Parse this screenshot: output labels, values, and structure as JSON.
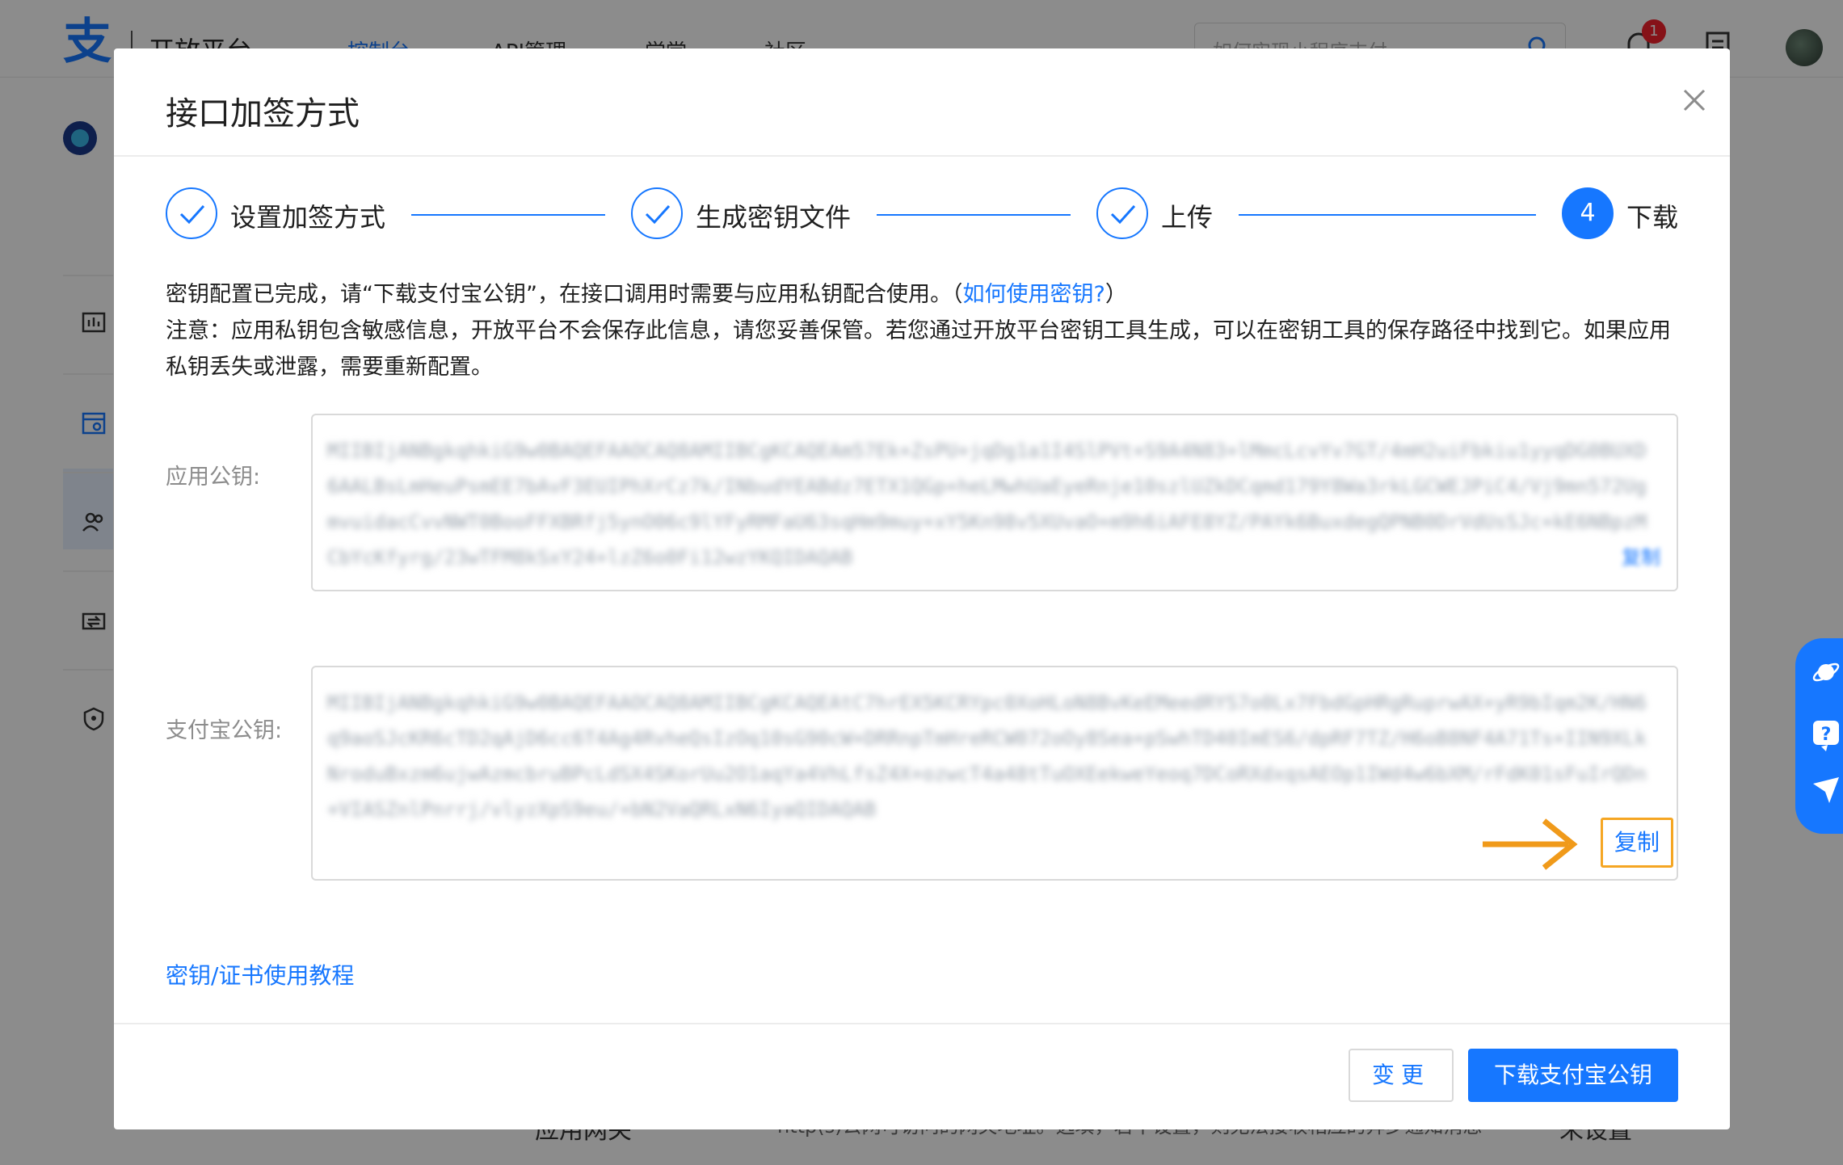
{
  "topbar": {
    "logo_glyph": "支",
    "logo_text": "开放平台",
    "nav": [
      "控制台",
      "API管理",
      "学堂",
      "社区"
    ],
    "search_placeholder": "如何实现小程序支付",
    "notification_count": "1"
  },
  "background": {
    "gateway_label": "应用网关",
    "gateway_desc": "http(s)公网可访问的网关地址。选填，若不设置，则无法接收相应的异步通知消息",
    "gateway_value": "未设置"
  },
  "modal": {
    "title": "接口加签方式",
    "steps": [
      {
        "label": "设置加签方式",
        "status": "done"
      },
      {
        "label": "生成密钥文件",
        "status": "done"
      },
      {
        "label": "上传",
        "status": "done"
      },
      {
        "label": "下载",
        "status": "current",
        "number": "4"
      }
    ],
    "desc_line1_before": "密钥配置已完成，请“下载支付宝公钥”，在接口调用时需要与应用私钥配合使用。（",
    "desc_link": "如何使用密钥?",
    "desc_line1_after": "）",
    "desc_line2": "注意：应用私钥包含敏感信息，开放平台不会保存此信息，请您妥善保管。若您通过开放平台密钥工具生成，可以在密钥工具的保存路径中找到它。如果应用私钥丢失或泄露，需要重新配置。",
    "app_key_label": "应用公钥:",
    "app_key_value": "MIIBIjANBgkqhkiG9w0BAQEFAAOCAQ8AMIIBCgKCAQEAm57Ek+ZsPU+jqDg1a1I4SlPVt+S9A4N83+lMmcLcvYv7GT/4mH2uiFbkiu1yyqDG0BUXD6AALBsLmHeuPsmEE7bAvF3EUIPhXrCz7k/INbudYEABdz7ETX1QGp+heLMwhUaEyeRnje10szlUZkDCqmd179Y8Wa3rkLGCWEJPiC4/Vj9mn572UgmvuidacCvvNWT0BooFFXBRfj5ynO06c9lYFyRMFaU63sqHm9muy+xY5Kn98v5XUvaO+m9h6iAFE8YZ/PAYk6BuxdegQPNB0DrVdUsSJc+kE6NBpzMCbYcKfyrg/23wTFM8kSxY24+lzZ6o0Fi12wzYKQIDAQAB",
    "alipay_key_label": "支付宝公钥:",
    "alipay_key_value": "MIIBIjANBgkqhkiG9w0BAQEFAAOCAQ8AMIIBCgKCAQEAtC7hrEX5KCRYpc0XoHLoN8BvKeEMeedRYS7o0Lx7FbdGpHRgRuprwAX+yR9bIqm2K/HN6q9aoSJcKR6cTD2qAjD6cc6T4Ag4RvheQsIzOq10sG90cW+DRRnpTmHreRCW072oOy8Sea+pSwhTD40ImES6/dpRF7TZ/H6oB8NF4A71Ts+IIN9XLkNroduBxzm6ujwAzmcbruBPcLdSX4SKorUu2O1aqYa4VhLfsZ4X+ozwcT4a48tTuOXEekweYeoq7DCoRXdxqsAEOp1IWd4w6bXM/rFdK01sFuIrQDn+VIASZnlPnrrj/vlyzXpS9eu/+bN2VaQRLxN6IyaQIDAQAB",
    "copy_label_blurred": "复制",
    "copy_label": "复制",
    "tutorial_link": "密钥/证书使用教程",
    "btn_change": "变更",
    "btn_download": "下载支付宝公钥"
  },
  "colors": {
    "primary": "#1677ff",
    "highlight": "#f5a623"
  }
}
